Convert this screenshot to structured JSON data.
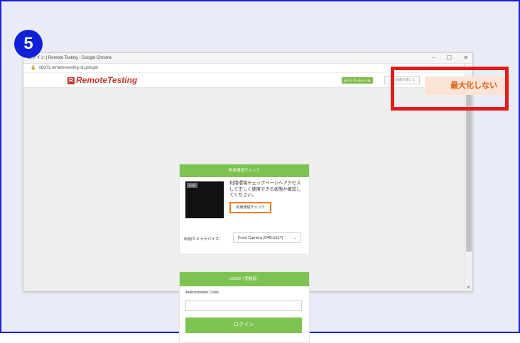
{
  "step": {
    "number": "5"
  },
  "browser": {
    "title": "ログイン | Remote Testing - Google Chrome",
    "url": "iibc01.remote-testing-st.jp/login",
    "window_controls": [
      "−",
      "☐",
      "✕"
    ]
  },
  "site": {
    "logo_text": "RemoteTesting",
    "env_chip": "iibc01.rtc-plus-st.jp",
    "close_window_button": "この画面を閉じる"
  },
  "env_check": {
    "header": "利用環境チェック",
    "live_badge": "LIVE",
    "description": "利用環境チェックページへアクセスして正しく使用できる状態か確認してください。",
    "check_button": "利用環境チェック",
    "camera_label": "利用カメラデバイス：",
    "camera_value": "Front Camera (04f2:b517)"
  },
  "login": {
    "header": "LOGIN（受験者）",
    "auth_code_label": "Authorization Code",
    "auth_code_value": "",
    "button": "ログイン"
  },
  "annotation": {
    "popup_text": "最大化しない"
  },
  "colors": {
    "accent_green": "#7cc350",
    "highlight_red": "#e21b1b",
    "step_blue": "#0f20d8",
    "popup_orange": "#e06016"
  }
}
